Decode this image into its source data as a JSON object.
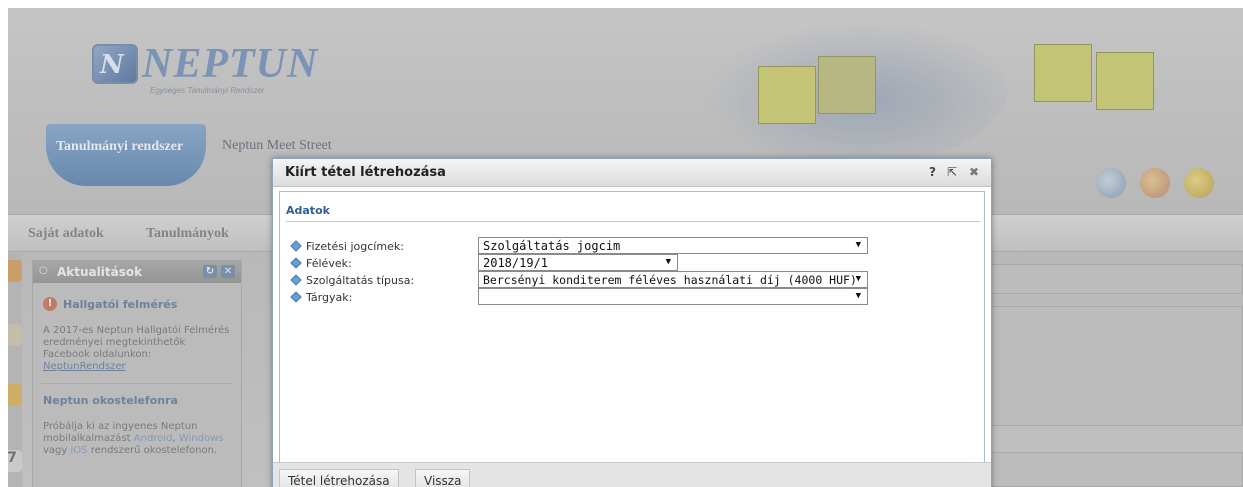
{
  "app": {
    "logo_text": "NEPTUN",
    "logo_subtitle": "Egységes Tanulmányi Rendszer",
    "main_tab": "Tanulmányi rendszer",
    "top_links": [
      "Neptun Meet Street"
    ]
  },
  "menu": {
    "items": [
      "Saját adatok",
      "Tanulmányok"
    ]
  },
  "sidebar": {
    "box_title": "Aktualitások",
    "news": [
      {
        "title": "Hallgatói felmérés",
        "text": "A 2017-es Neptun Hallgatói Felmérés eredményei megtekinthetők Facebook oldalunkon:",
        "link": "NeptunRendszer"
      },
      {
        "title": "Neptun okostelefonra",
        "text_before": "Próbálja ki az ingyenes Neptun mobilalkalmazást",
        "link1": "Android",
        "sep": ",",
        "link2": "Windows",
        "mid": "vagy",
        "link3": "iOS",
        "text_after": "rendszerű okostelefonon."
      }
    ],
    "side_number": "7"
  },
  "dialog": {
    "title": "Kiírt tétel létrehozása",
    "help": "?",
    "popout": "⇱",
    "close": "✖",
    "section": "Adatok",
    "fields": [
      {
        "label": "Fizetési jogcímek:",
        "value": "Szolgáltatás jogcim"
      },
      {
        "label": "Félévek:",
        "value": "2018/19/1"
      },
      {
        "label": "Szolgáltatás típusa:",
        "value": "Bercsényi konditerem féléves használati díj (4000 HUF)"
      },
      {
        "label": "Tárgyak:",
        "value": ""
      }
    ],
    "buttons": {
      "create": "Tétel létrehozása",
      "back": "Vissza"
    }
  },
  "colors": {
    "accent": "#2f5f93",
    "tab_blue": "#6b90ba",
    "overlay_gray": "#c0c0c0"
  }
}
